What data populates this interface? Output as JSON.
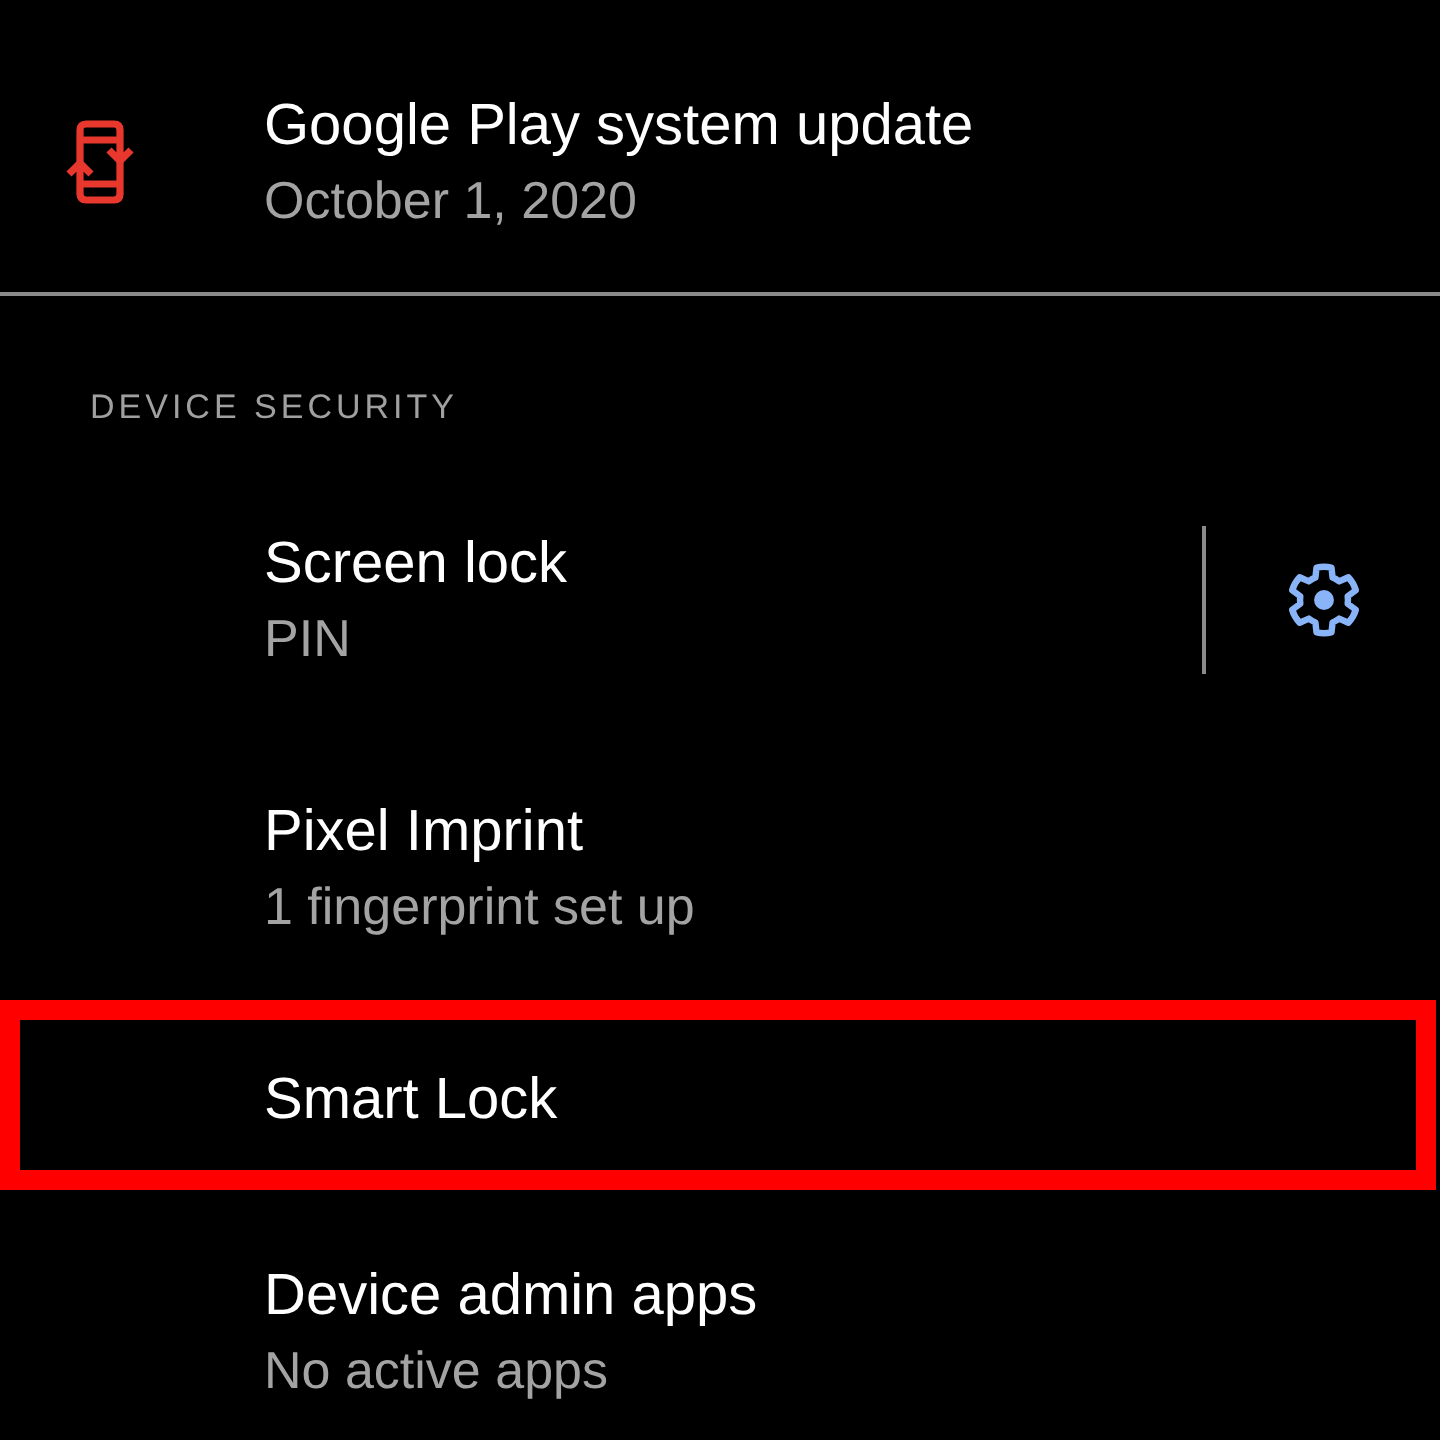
{
  "top_item": {
    "title": "Google Play system update",
    "subtitle": "October 1, 2020"
  },
  "section": {
    "header": "DEVICE SECURITY",
    "items": [
      {
        "kind": "gear",
        "title": "Screen lock",
        "subtitle": "PIN",
        "highlighted": false
      },
      {
        "kind": "plain",
        "title": "Pixel Imprint",
        "subtitle": "1 fingerprint set up",
        "highlighted": false
      },
      {
        "kind": "plain",
        "title": "Smart Lock",
        "highlighted": true
      },
      {
        "kind": "plain",
        "title": "Device admin apps",
        "subtitle": "No active apps",
        "highlighted": false
      }
    ]
  }
}
